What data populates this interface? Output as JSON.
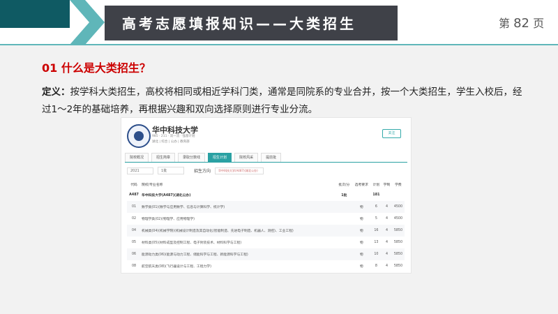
{
  "header": {
    "title": "高考志愿填报知识——大类招生",
    "page_prefix": "第",
    "page_number": "82",
    "page_suffix": "页"
  },
  "section": {
    "heading": "01 什么是大类招生？",
    "definition_label": "定义：",
    "definition_text": "按学科大类招生，高校将相同或相近学科门类，通常是同院系的专业合并，按一个大类招生，学生入校后，经过1～2年的基础培养，再根据兴趣和双向选择原则进行专业分流。"
  },
  "screenshot": {
    "university_name": "华中科技大学",
    "tags": "985 · 211 · 双一流 · 强基计划",
    "location": "湖北 | 综合 | 公办 | 教育部",
    "follow_label": "关注",
    "tabs": [
      "院校概况",
      "招生简章",
      "录取分数线",
      "招生计划",
      "院校风采",
      "提前批"
    ],
    "active_tab": "招生计划",
    "filters": {
      "year": "2021",
      "batch": "1批",
      "direction_label": "招生方向",
      "direction_value": "华中科技大学(A487)(湖北公办)"
    },
    "columns": [
      "代码",
      "院校/专业名称",
      "批次/分",
      "选考要求",
      "计划",
      "学制",
      "学费"
    ],
    "rows": [
      {
        "code": "A487",
        "name": "华中科技大学(A487)(湖北公办)",
        "batch": "1批",
        "req": "",
        "plan": "181",
        "years": "",
        "fee": ""
      },
      {
        "code": "01",
        "name": "数学类(01)(数学与应用数学、信息与计算科学、统计学)",
        "batch": "",
        "req": "物",
        "plan": "6",
        "years": "4",
        "fee": "4500"
      },
      {
        "code": "02",
        "name": "物理学类(02)(物理学、应用物理学)",
        "batch": "",
        "req": "物",
        "plan": "5",
        "years": "4",
        "fee": "4500"
      },
      {
        "code": "04",
        "name": "机械类(04)(机械学院)(机械设计制造及其自动化(智能制造、先进电子制造、机器人、测控)、工业工程)",
        "batch": "",
        "req": "物",
        "plan": "16",
        "years": "4",
        "fee": "5850"
      },
      {
        "code": "05",
        "name": "材料类(05)(材料成型及控制工程、电子封装技术、材料科学与工程)",
        "batch": "",
        "req": "物",
        "plan": "13",
        "years": "4",
        "fee": "5850"
      },
      {
        "code": "06",
        "name": "能源动力类(06)(能源与动力工程、储能科学与工程、新能源科学与工程)",
        "batch": "",
        "req": "物",
        "plan": "10",
        "years": "4",
        "fee": "5850"
      },
      {
        "code": "08",
        "name": "航空航天类(08)(飞行器设计与工程、工程力学)",
        "batch": "",
        "req": "物",
        "plan": "8",
        "years": "4",
        "fee": "5850"
      }
    ]
  }
}
